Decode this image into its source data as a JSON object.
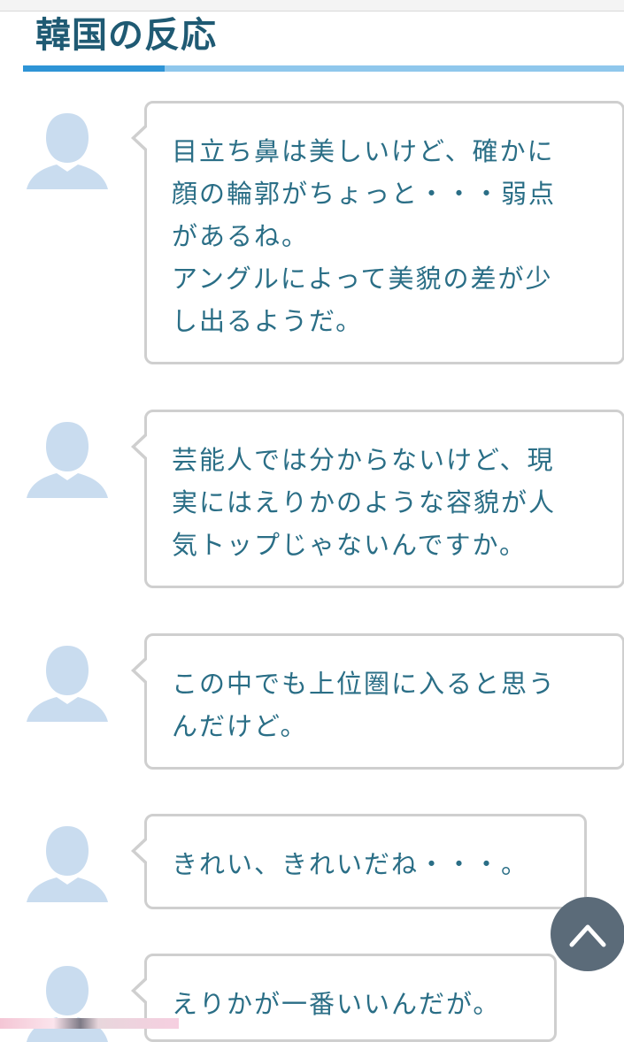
{
  "heading": {
    "title": "韓国の反応"
  },
  "colors": {
    "heading": "#1f5a73",
    "underline": "#8fc7ec",
    "underline_accent": "#2e94d6",
    "comment_text": "#2a6e86",
    "bubble_border": "#cfcfcf",
    "avatar": "#c9dcef",
    "scroll_button": "#5b6b79"
  },
  "comments": [
    {
      "avatar_icon": "user-silhouette-icon",
      "text": "目立ち鼻は美しいけど、確かに\n顔の輪郭がちょっと・・・弱点\nがあるね。\nアングルによって美貌の差が少\nし出るようだ。"
    },
    {
      "avatar_icon": "user-silhouette-icon",
      "text": "芸能人では分からないけど、現\n実にはえりかのような容貌が人\n気トップじゃないんですか。"
    },
    {
      "avatar_icon": "user-silhouette-icon",
      "text": "この中でも上位圏に入ると思う\nんだけど。"
    },
    {
      "avatar_icon": "user-silhouette-icon",
      "text": "きれい、きれいだね・・・。"
    },
    {
      "avatar_icon": "user-silhouette-icon",
      "text": "えりかが一番いいんだが。"
    }
  ],
  "scroll_top": {
    "icon": "chevron-up-icon"
  }
}
